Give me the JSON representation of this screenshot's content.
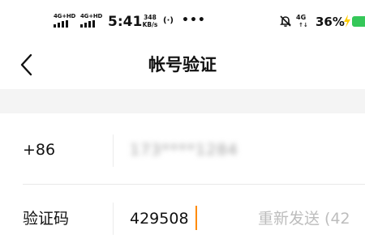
{
  "status_bar": {
    "network1": "4G+HD",
    "network2": "4G+HD",
    "time": "5:41",
    "speed_value": "348",
    "speed_unit": "KB/s",
    "hotspot_icon": "hotspot-icon",
    "more": "•••",
    "mute_icon": "bell-off-icon",
    "network3": "4G",
    "network3_arrows": "↑↓",
    "battery_percent": "36%",
    "battery_color": "#35c759",
    "charging_color": "#ffcc00"
  },
  "nav": {
    "back_icon": "chevron-left-icon",
    "title": "帐号验证"
  },
  "form": {
    "phone": {
      "label": "+86",
      "value": "173****1284"
    },
    "code": {
      "label": "验证码",
      "value": "429508",
      "caret_color": "#ff8a00",
      "resend_label": "重新发送 (42"
    }
  }
}
